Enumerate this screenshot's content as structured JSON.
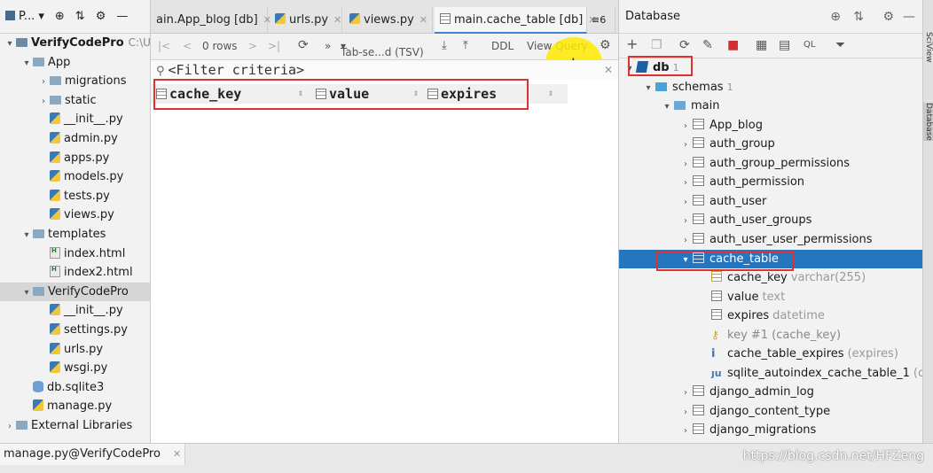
{
  "project": {
    "toolbar_label": "P...",
    "tree": [
      {
        "label": "VerifyCodePro",
        "hint": "C:\\Use",
        "type": "project",
        "indent": 0,
        "expanded": true
      },
      {
        "label": "App",
        "type": "folder",
        "indent": 1,
        "expanded": true
      },
      {
        "label": "migrations",
        "type": "folder",
        "indent": 2,
        "expanded": false
      },
      {
        "label": "static",
        "type": "folder",
        "indent": 2,
        "expanded": false
      },
      {
        "label": "__init__.py",
        "type": "py",
        "indent": 2
      },
      {
        "label": "admin.py",
        "type": "py",
        "indent": 2
      },
      {
        "label": "apps.py",
        "type": "py",
        "indent": 2
      },
      {
        "label": "models.py",
        "type": "py",
        "indent": 2
      },
      {
        "label": "tests.py",
        "type": "py",
        "indent": 2
      },
      {
        "label": "views.py",
        "type": "py",
        "indent": 2
      },
      {
        "label": "templates",
        "type": "folder",
        "indent": 1,
        "expanded": true
      },
      {
        "label": "index.html",
        "type": "html",
        "indent": 2
      },
      {
        "label": "index2.html",
        "type": "html",
        "indent": 2
      },
      {
        "label": "VerifyCodePro",
        "type": "folder",
        "indent": 1,
        "expanded": true,
        "selected": true
      },
      {
        "label": "__init__.py",
        "type": "py",
        "indent": 2
      },
      {
        "label": "settings.py",
        "type": "py",
        "indent": 2
      },
      {
        "label": "urls.py",
        "type": "py",
        "indent": 2
      },
      {
        "label": "wsgi.py",
        "type": "py",
        "indent": 2
      },
      {
        "label": "db.sqlite3",
        "type": "db",
        "indent": 1
      },
      {
        "label": "manage.py",
        "type": "py",
        "indent": 1
      },
      {
        "label": "External Libraries",
        "type": "lib",
        "indent": 0,
        "expanded": false
      }
    ]
  },
  "tabs": [
    {
      "label": "ain.App_blog [db]",
      "icon": "grid",
      "active": false
    },
    {
      "label": "urls.py",
      "icon": "py",
      "active": false
    },
    {
      "label": "views.py",
      "icon": "py",
      "active": false
    },
    {
      "label": "main.cache_table [db]",
      "icon": "grid",
      "active": true
    }
  ],
  "tabs_overflow": "≡6",
  "data_toolbar": {
    "rows": "0 rows",
    "format": "Tab-se...d (TSV)",
    "ddl": "DDL",
    "view_query": "View Query"
  },
  "filter": {
    "placeholder": "<Filter criteria>"
  },
  "columns": [
    "cache_key",
    "value",
    "expires"
  ],
  "database": {
    "title": "Database",
    "nodes": [
      {
        "label": "db",
        "count": "1",
        "type": "db",
        "indent": 0
      },
      {
        "label": "schemas",
        "count": "1",
        "type": "schemas",
        "indent": 1
      },
      {
        "label": "main",
        "type": "schema",
        "indent": 2
      },
      {
        "label": "App_blog",
        "type": "table",
        "indent": 3
      },
      {
        "label": "auth_group",
        "type": "table",
        "indent": 3
      },
      {
        "label": "auth_group_permissions",
        "type": "table",
        "indent": 3
      },
      {
        "label": "auth_permission",
        "type": "table",
        "indent": 3
      },
      {
        "label": "auth_user",
        "type": "table",
        "indent": 3
      },
      {
        "label": "auth_user_groups",
        "type": "table",
        "indent": 3
      },
      {
        "label": "auth_user_user_permissions",
        "type": "table",
        "indent": 3
      },
      {
        "label": "cache_table",
        "type": "table",
        "indent": 3,
        "selected": true,
        "expanded": true
      },
      {
        "label": "cache_key",
        "hint": "varchar(255)",
        "type": "pkcol",
        "indent": 4
      },
      {
        "label": "value",
        "hint": "text",
        "type": "col",
        "indent": 4
      },
      {
        "label": "expires",
        "hint": "datetime",
        "type": "col",
        "indent": 4
      },
      {
        "label": "key #1 (cache_key)",
        "type": "key",
        "indent": 4
      },
      {
        "label": "cache_table_expires",
        "hint": "(expires)",
        "type": "index",
        "indent": 4
      },
      {
        "label": "sqlite_autoindex_cache_table_1",
        "hint": "(cach",
        "type": "uindex",
        "indent": 4
      },
      {
        "label": "django_admin_log",
        "type": "table",
        "indent": 3
      },
      {
        "label": "django_content_type",
        "type": "table",
        "indent": 3
      },
      {
        "label": "django_migrations",
        "type": "table",
        "indent": 3
      }
    ]
  },
  "side_strip": [
    "SciView",
    "Database"
  ],
  "bottom": {
    "run_tab": "manage.py@VerifyCodePro",
    "watermark": "https://blog.csdn.net/HFZeng"
  },
  "colors": {
    "selection": "#2675bf",
    "highlight_box": "#e03030",
    "cursor_halo": "#ffeb00"
  }
}
